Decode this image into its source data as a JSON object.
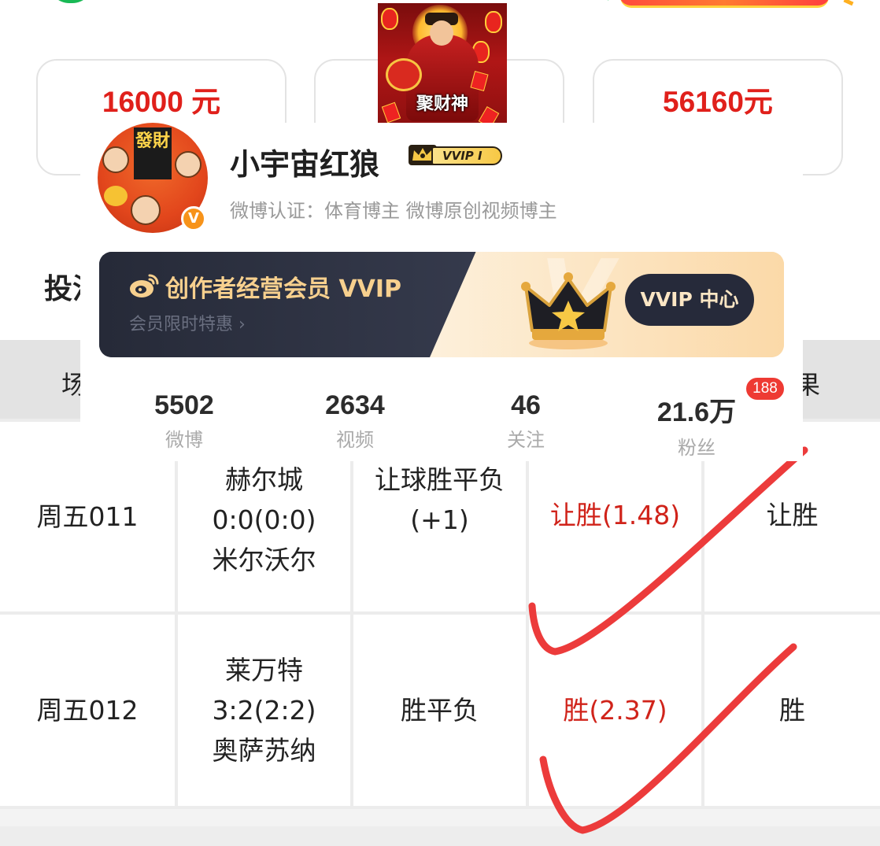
{
  "top_amounts": {
    "left": "16000 元",
    "right": "56160元"
  },
  "thumbnail": {
    "caption": "聚财神"
  },
  "avatar_banner_text": "發財",
  "profile": {
    "nickname": "小宇宙红狼",
    "vvip_badge": "VVIP I",
    "verification": "微博认证：体育博主 微博原创视频博主",
    "verified_icon_char": "V"
  },
  "vvip_banner": {
    "title": "创作者经营会员 VVIP",
    "subtitle": "会员限时特惠 ›",
    "center_button": "VVIP 中心"
  },
  "stats": [
    {
      "value": "5502",
      "label": "微博"
    },
    {
      "value": "2634",
      "label": "视频"
    },
    {
      "value": "46",
      "label": "关注"
    },
    {
      "value": "21.6万",
      "label": "粉丝"
    }
  ],
  "fans_badge": "188",
  "section_title": "投注",
  "table": {
    "header_first": "场",
    "header_last": "果",
    "rows": [
      {
        "match_no": "周五011",
        "home": "赫尔城",
        "score": "0:0(0:0)",
        "away": "米尔沃尔",
        "play": "让球胜平负",
        "play_extra": "(+1)",
        "pick": "让胜(1.48)",
        "result": "让胜"
      },
      {
        "match_no": "周五012",
        "home": "莱万特",
        "score": "3:2(2:2)",
        "away": "奥萨苏纳",
        "play": "胜平负",
        "play_extra": "",
        "pick": "胜(2.37)",
        "result": "胜"
      }
    ]
  },
  "colors": {
    "amount_red": "#e0201b",
    "pick_red": "#d0231a",
    "check_red": "#ec3b3b",
    "banner_dark": "#262a38",
    "badge_red": "#ee3a33"
  },
  "icons": [
    "verified-icon",
    "crown-icon",
    "weibo-logo-icon",
    "vvip-crown-icon",
    "check-mark-icon"
  ]
}
